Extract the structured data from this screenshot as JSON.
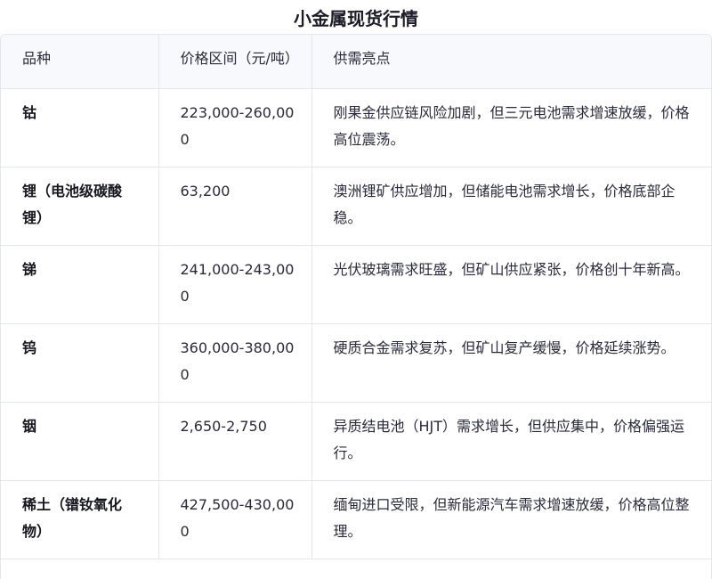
{
  "title": "小金属现货行情",
  "table": {
    "headers": [
      "品种",
      "价格区间（元/吨）",
      "供需亮点"
    ],
    "rows": [
      {
        "variety": "钴",
        "range": "223,000-260,000",
        "highlight": "刚果金供应链风险加剧，但三元电池需求增速放缓，价格高位震荡。"
      },
      {
        "variety": "锂（电池级碳酸锂）",
        "range": "63,200",
        "highlight": "澳洲锂矿供应增加，但储能电池需求增长，价格底部企稳。"
      },
      {
        "variety": "锑",
        "range": "241,000-243,000",
        "highlight": "光伏玻璃需求旺盛，但矿山供应紧张，价格创十年新高。"
      },
      {
        "variety": "钨",
        "range": "360,000-380,000",
        "highlight": "硬质合金需求复苏，但矿山复产缓慢，价格延续涨势。"
      },
      {
        "variety": "铟",
        "range": "2,650-2,750",
        "highlight": "异质结电池（HJT）需求增长，但供应集中，价格偏强运行。"
      },
      {
        "variety": "稀土（镨钕氧化物）",
        "range": "427,500-430,000",
        "highlight": "缅甸进口受限，但新能源汽车需求增速放缓，价格高位整理。"
      }
    ]
  }
}
